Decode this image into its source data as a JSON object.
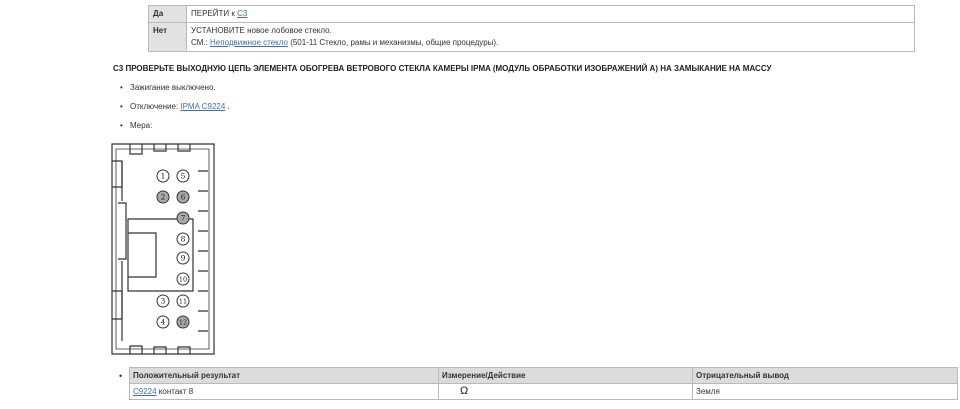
{
  "decision_table": {
    "rows": [
      {
        "key": "Да",
        "line1_prefix": "ПЕРЕЙТИ к ",
        "line1_link": "C3"
      },
      {
        "key": "Нет",
        "line1": "УСТАНОВИТЕ новое лобовое стекло.",
        "line2_prefix": "СМ.: ",
        "line2_link": "Неподвижное стекло",
        "line2_suffix": " (501-11 Стекло, рамы и механизмы, общие процедуры)."
      }
    ]
  },
  "step": {
    "heading": "C3 ПРОВЕРЬТЕ ВЫХОДНУЮ ЦЕПЬ ЭЛЕМЕНТА ОБОГРЕВА ВЕТРОВОГО СТЕКЛА КАМЕРЫ IPMA (МОДУЛЬ ОБРАБОТКИ ИЗОБРАЖЕНИЙ A) НА ЗАМЫКАНИЕ НА МАССУ",
    "bullets": {
      "ignition": "Зажигание выключено.",
      "disconnect_prefix": "Отключение: ",
      "disconnect_link": "IPMA C9224",
      "disconnect_suffix": " .",
      "measure": "Мера:"
    }
  },
  "connector": {
    "pins": [
      "1",
      "2",
      "3",
      "4",
      "5",
      "6",
      "7",
      "8",
      "9",
      "10",
      "11",
      "12"
    ],
    "shaded_pins": [
      "2",
      "6",
      "7",
      "12"
    ]
  },
  "result_table": {
    "headers": [
      "Положительный результат",
      "Измерение/Действие",
      "Отрицательный вывод"
    ],
    "row": {
      "link": "C9224",
      "pin": " контакт 8",
      "action_symbol": "Ω",
      "negative": "Земля"
    }
  },
  "colors": {
    "link": "#3b6fb6",
    "header_bg": "#dcdcdc",
    "key_bg": "#e2e2e2",
    "shaded_pin": "#a9a9a9"
  }
}
